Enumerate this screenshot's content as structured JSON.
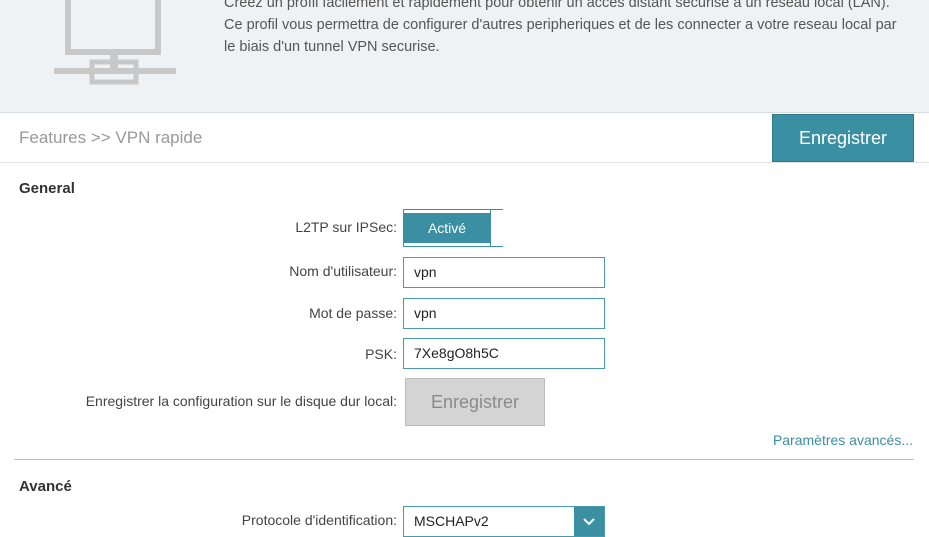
{
  "banner": {
    "line1": "Creez un profil facilement et rapidement pour obtenir un acces distant securise a un reseau local (LAN).",
    "line2": "Ce profil vous permettra de configurer d'autres peripheriques et de les connecter a votre reseau local par",
    "line3": "le biais d'un tunnel VPN securise.",
    "icon": "network-computer-icon"
  },
  "breadcrumb": "Features >> VPN rapide",
  "save_button": "Enregistrer",
  "general": {
    "title": "General",
    "l2tp_label": "L2TP sur IPSec:",
    "l2tp_state": "Activé",
    "username_label": "Nom d'utilisateur:",
    "username_value": "vpn",
    "password_label": "Mot de passe:",
    "password_value": "vpn",
    "psk_label": "PSK:",
    "psk_value": "7Xe8gO8h5C",
    "save_disk_label": "Enregistrer la configuration sur le disque dur local:",
    "save_disk_button": "Enregistrer",
    "advanced_link": "Paramètres avancés..."
  },
  "advanced": {
    "title": "Avancé",
    "auth_label": "Protocole d'identification:",
    "auth_value": "MSCHAPv2"
  },
  "colors": {
    "accent": "#3b8fa3",
    "banner_bg": "#eef2f5"
  }
}
